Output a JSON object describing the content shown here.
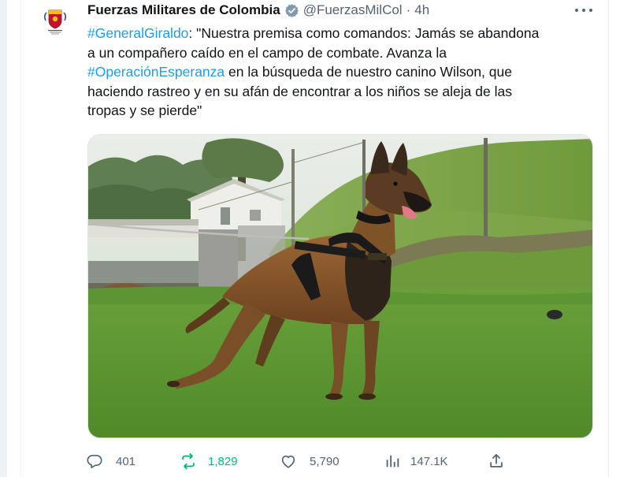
{
  "tweet": {
    "display_name": "Fuerzas Militares de Colombia",
    "handle": "@FuerzasMilCol",
    "separator": "·",
    "time": "4h",
    "lines": [
      [
        {
          "text": "#GeneralGiraldo",
          "hashtag": true
        },
        {
          "text": ": \"Nuestra premisa como comandos: Jamás se abandona",
          "hashtag": false
        }
      ],
      [
        {
          "text": "a un compañero caído en el campo de combate. Avanza la",
          "hashtag": false
        }
      ],
      [
        {
          "text": "#OperaciónEsperanza",
          "hashtag": true
        },
        {
          "text": " en la búsqueda de nuestro canino Wilson, que",
          "hashtag": false
        }
      ],
      [
        {
          "text": "haciendo rastreo y en su afán de encontrar a los niños se aleja de las",
          "hashtag": false
        }
      ],
      [
        {
          "text": "tropas y se pierde\"",
          "hashtag": false
        }
      ]
    ],
    "media": {
      "description_icon": "photo-of-belgian-malinois-dog"
    }
  },
  "actions": {
    "reply_count": "401",
    "retweet_count": "1,829",
    "like_count": "5,790",
    "views_count": "147.1K"
  },
  "colors": {
    "hashtag": "#1d9bf0",
    "retweet": "#00ba7c",
    "muted": "#536471",
    "verified_badge": "#829aab"
  }
}
